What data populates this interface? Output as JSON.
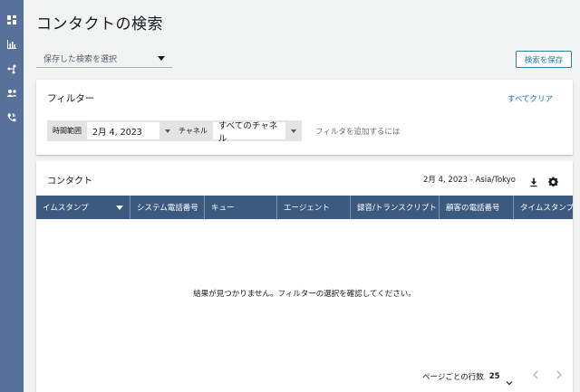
{
  "sidebar": {
    "items": [
      {
        "icon": "dashboard-icon"
      },
      {
        "icon": "bar-chart-icon"
      },
      {
        "icon": "routing-icon"
      },
      {
        "icon": "users-icon"
      },
      {
        "icon": "phone-icon"
      }
    ],
    "background": "#57719b"
  },
  "page": {
    "title": "コンタクトの検索"
  },
  "saved_search": {
    "placeholder": "保存した検索を選択"
  },
  "save_search_button": {
    "label": "検索を保存"
  },
  "filters": {
    "title": "フィルター",
    "clear_all": "すべてクリア",
    "time_range": {
      "label": "時間範囲",
      "value": "2月 4, 2023"
    },
    "channel": {
      "label": "チャネル",
      "value": "すべてのチャネル"
    },
    "add_filter_placeholder": "フィルタを追加するには"
  },
  "contacts": {
    "title": "コンタクト",
    "date_timezone": "2月 4, 2023 - Asia/Tokyo",
    "columns": [
      {
        "label": "イムスタンプ",
        "sorted": true
      },
      {
        "label": "システム電話番号"
      },
      {
        "label": "キュー"
      },
      {
        "label": "エージェント"
      },
      {
        "label": "録音/トランスクリプト"
      },
      {
        "label": "顧客の電話番号"
      },
      {
        "label": "タイムスタンプ"
      }
    ],
    "empty_message": "結果が見つかりません。フィルターの選択を確認してください。",
    "pagination": {
      "rows_per_page_label": "ページごとの行数",
      "rows_per_page_value": "25"
    }
  },
  "colors": {
    "accent": "#0073bb",
    "table_header": "#3c5a80",
    "background": "#f2f3f3"
  }
}
